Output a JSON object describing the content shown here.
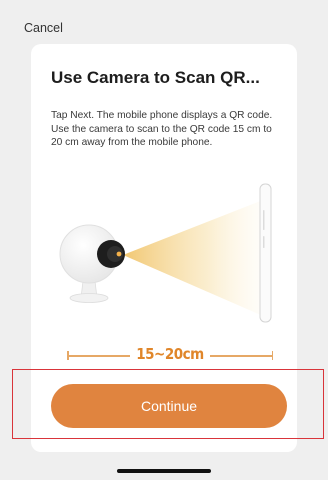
{
  "header": {
    "cancel_label": "Cancel"
  },
  "card": {
    "title": "Use Camera to Scan QR...",
    "description": "Tap Next. The mobile phone displays a QR code. Use the camera to scan to the QR code 15 cm to 20 cm away from the mobile phone.",
    "distance_label": "15~20cm"
  },
  "actions": {
    "continue_label": "Continue"
  },
  "colors": {
    "accent": "#e0843f",
    "highlight_border": "#d9343a",
    "background": "#efefef"
  },
  "icons": [
    "camera-icon",
    "phone-icon"
  ]
}
